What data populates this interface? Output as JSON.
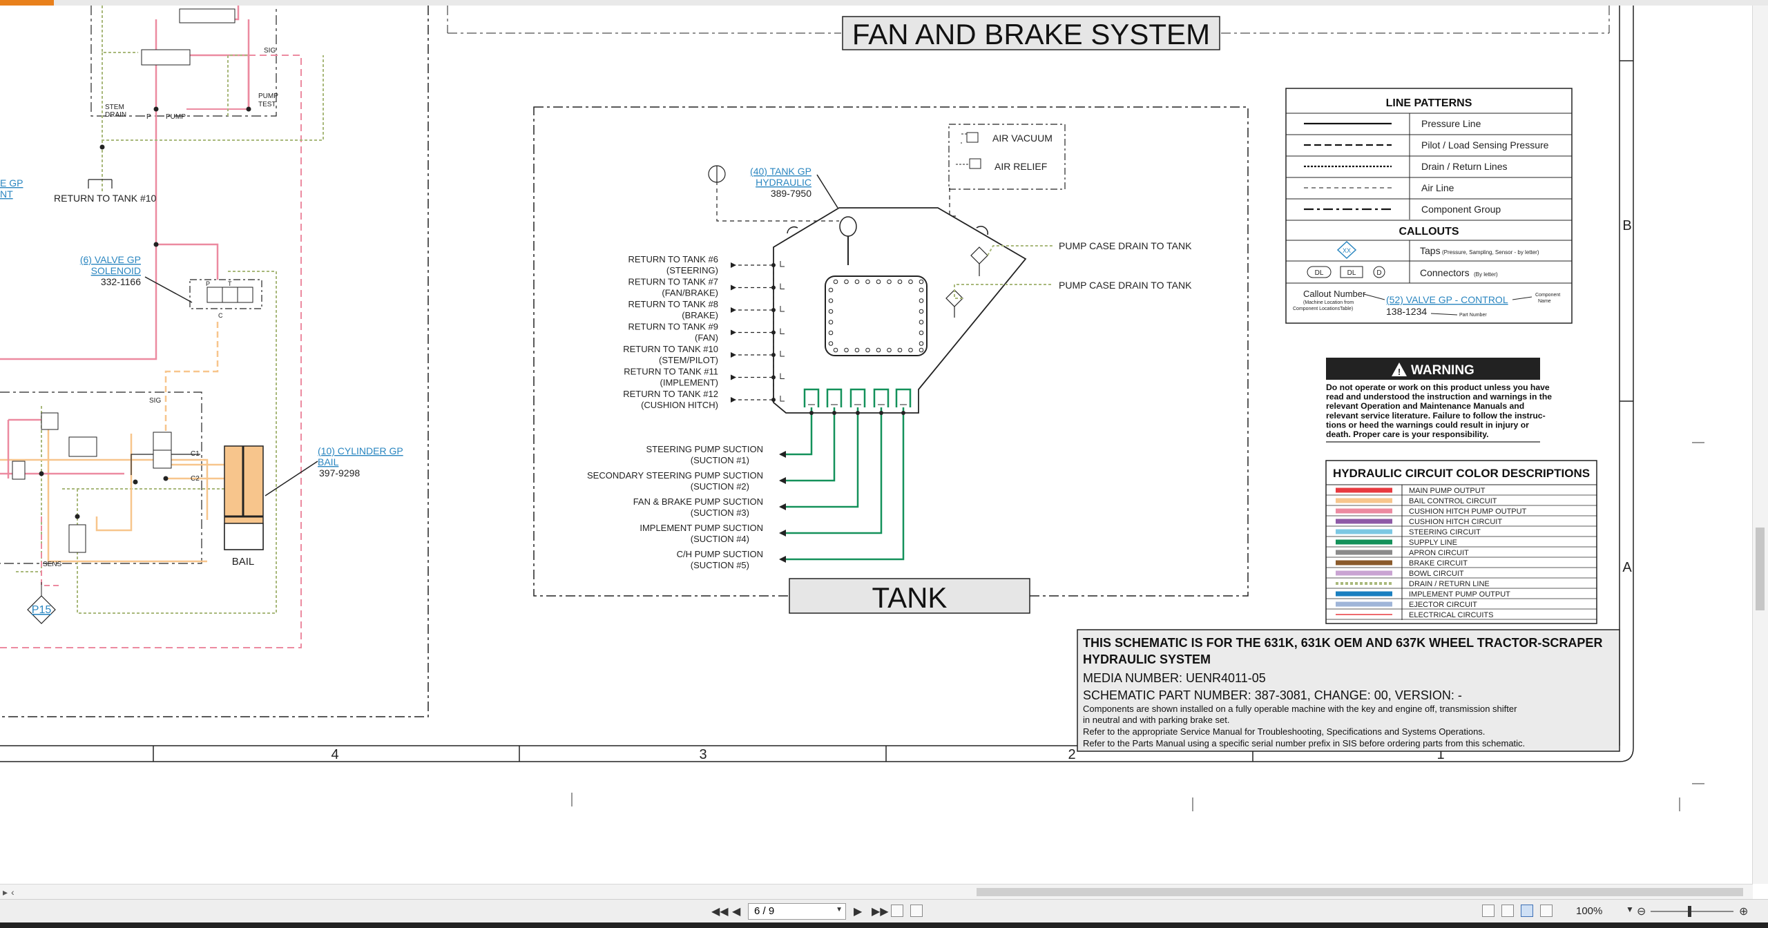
{
  "title": "FAN AND BRAKE SYSTEM",
  "tank_title": "TANK",
  "tank_callout": {
    "name1": "(40) TANK GP",
    "name2": "HYDRAULIC",
    "part": "389-7950"
  },
  "valve_callout": {
    "name1": "(6) VALVE GP",
    "name2": "SOLENOID",
    "part": "332-1166"
  },
  "cylinder_callout": {
    "name1": "(10) CYLINDER GP",
    "name2": "BAIL",
    "part": "397-9298"
  },
  "left_partial": {
    "line1": "E GP",
    "line2": "NT"
  },
  "left_labels": {
    "stem_drain1": "STEM",
    "stem_drain2": "DRAIN",
    "pump": "PUMP",
    "p": "P",
    "pump_test1": "PUMP",
    "pump_test2": "TEST",
    "sig": "SIG",
    "sig2": "SIG",
    "return10": "RETURN TO TANK #10",
    "bail": "BAIL",
    "sens": "SENS",
    "p15": "P15",
    "c1": "C1",
    "c2": "C2",
    "v_p": "P",
    "v_t": "T",
    "v_c": "C"
  },
  "air_box": {
    "vacuum": "AIR VACUUM",
    "relief": "AIR RELIEF"
  },
  "pump_case_drain": [
    "PUMP CASE DRAIN TO TANK",
    "PUMP CASE DRAIN TO TANK"
  ],
  "returns": [
    {
      "l1": "RETURN TO TANK #6",
      "l2": "(STEERING)"
    },
    {
      "l1": "RETURN TO TANK #7",
      "l2": "(FAN/BRAKE)"
    },
    {
      "l1": "RETURN TO TANK #8",
      "l2": "(BRAKE)"
    },
    {
      "l1": "RETURN TO TANK #9",
      "l2": "(FAN)"
    },
    {
      "l1": "RETURN TO TANK #10",
      "l2": "(STEM/PILOT)"
    },
    {
      "l1": "RETURN TO TANK #11",
      "l2": "(IMPLEMENT)"
    },
    {
      "l1": "RETURN TO TANK #12",
      "l2": "(CUSHION HITCH)"
    }
  ],
  "suctions": [
    {
      "l1": "STEERING PUMP SUCTION",
      "l2": "(SUCTION #1)"
    },
    {
      "l1": "SECONDARY STEERING PUMP SUCTION",
      "l2": "(SUCTION #2)"
    },
    {
      "l1": "FAN & BRAKE PUMP SUCTION",
      "l2": "(SUCTION #3)"
    },
    {
      "l1": "IMPLEMENT PUMP SUCTION",
      "l2": "(SUCTION #4)"
    },
    {
      "l1": "C/H PUMP SUCTION",
      "l2": "(SUCTION #5)"
    }
  ],
  "line_patterns": {
    "title": "LINE PATTERNS",
    "items": [
      {
        "label": "Pressure Line",
        "dash": ""
      },
      {
        "label": "Pilot / Load Sensing Pressure",
        "dash": "10 5"
      },
      {
        "label": "Drain / Return Lines",
        "dash": "3 2"
      },
      {
        "label": "Air Line",
        "dash": "6 5"
      },
      {
        "label": "Component Group",
        "dash": "14 5 4 5"
      }
    ],
    "callouts_title": "CALLOUTS",
    "taps_label": "Taps",
    "taps_note": "(Pressure, Sampling, Sensor - by letter)",
    "taps_icon": "XX",
    "connectors_label": "Connectors",
    "connectors_note": "(By letter)",
    "connector_icons": [
      "DL",
      "DL",
      "D"
    ],
    "callout_number": "Callout Number",
    "callout_note1": "(Machine Location from",
    "callout_note2": "Component LocationsTable)",
    "callout_example": "(52) VALVE GP - CONTROL",
    "callout_part": "138-1234",
    "component_name1": "Component",
    "component_name2": "Name",
    "part_number_label": "Part Number"
  },
  "warning": {
    "title": "WARNING",
    "lines": [
      "Do not operate or work on this product unless you have",
      "read and understood the instruction and warnings in the",
      "relevant Operation and Maintenance Manuals and",
      "relevant service literature. Failure to follow the instruc-",
      "tions or heed the warnings could result in injury or",
      "death. Proper care is your responsibility."
    ]
  },
  "color_desc": {
    "title": "HYDRAULIC CIRCUIT COLOR DESCRIPTIONS",
    "items": [
      {
        "label": "MAIN PUMP OUTPUT",
        "color": "#e8393f",
        "style": "solid"
      },
      {
        "label": "BAIL CONTROL CIRCUIT",
        "color": "#f7c58c",
        "style": "solid"
      },
      {
        "label": "CUSHION HITCH PUMP OUTPUT",
        "color": "#ec8aa0",
        "style": "solid"
      },
      {
        "label": "CUSHION HITCH CIRCUIT",
        "color": "#8e5aa6",
        "style": "solid"
      },
      {
        "label": "STEERING CIRCUIT",
        "color": "#7cc8e3",
        "style": "solid"
      },
      {
        "label": "SUPPLY LINE",
        "color": "#13915a",
        "style": "solid"
      },
      {
        "label": "APRON CIRCUIT",
        "color": "#8a8a8a",
        "style": "solid"
      },
      {
        "label": "BRAKE CIRCUIT",
        "color": "#8a5a2b",
        "style": "solid"
      },
      {
        "label": "BOWL CIRCUIT",
        "color": "#c9a3d2",
        "style": "solid"
      },
      {
        "label": "DRAIN / RETURN LINE",
        "color": "#a8b87a",
        "style": "dotted"
      },
      {
        "label": "IMPLEMENT PUMP OUTPUT",
        "color": "#1a7fc0",
        "style": "solid"
      },
      {
        "label": "EJECTOR CIRCUIT",
        "color": "#9fb5d8",
        "style": "solid"
      },
      {
        "label": "ELECTRICAL CIRCUITS",
        "color": "#e8393f",
        "style": "thin"
      }
    ]
  },
  "info": {
    "line1": "THIS SCHEMATIC IS FOR THE 631K, 631K OEM AND 637K WHEEL TRACTOR-SCRAPER",
    "line2": "HYDRAULIC SYSTEM",
    "media": "MEDIA NUMBER: UENR4011-05",
    "part": "SCHEMATIC PART NUMBER: 387-3081, CHANGE: 00, VERSION: -",
    "notes": [
      "Components are shown installed on a fully operable machine with the key and engine off, transmission shifter",
      "in neutral and with parking brake set.",
      "Refer to the appropriate Service Manual for Troubleshooting, Specifications and Systems Operations.",
      "Refer to the Parts Manual using a specific serial number prefix in SIS before ordering parts from this schematic."
    ]
  },
  "zones": [
    "4",
    "3",
    "2",
    "1"
  ],
  "rows": [
    "B",
    "A"
  ],
  "viewer": {
    "page": "6 / 9",
    "zoom": "100%"
  },
  "colors": {
    "red": "#e8393f",
    "pink": "#ec8aa0",
    "orange": "#f7c58c",
    "green": "#13915a",
    "dashgreen": "#a8b87a",
    "link": "#2a86c0"
  }
}
